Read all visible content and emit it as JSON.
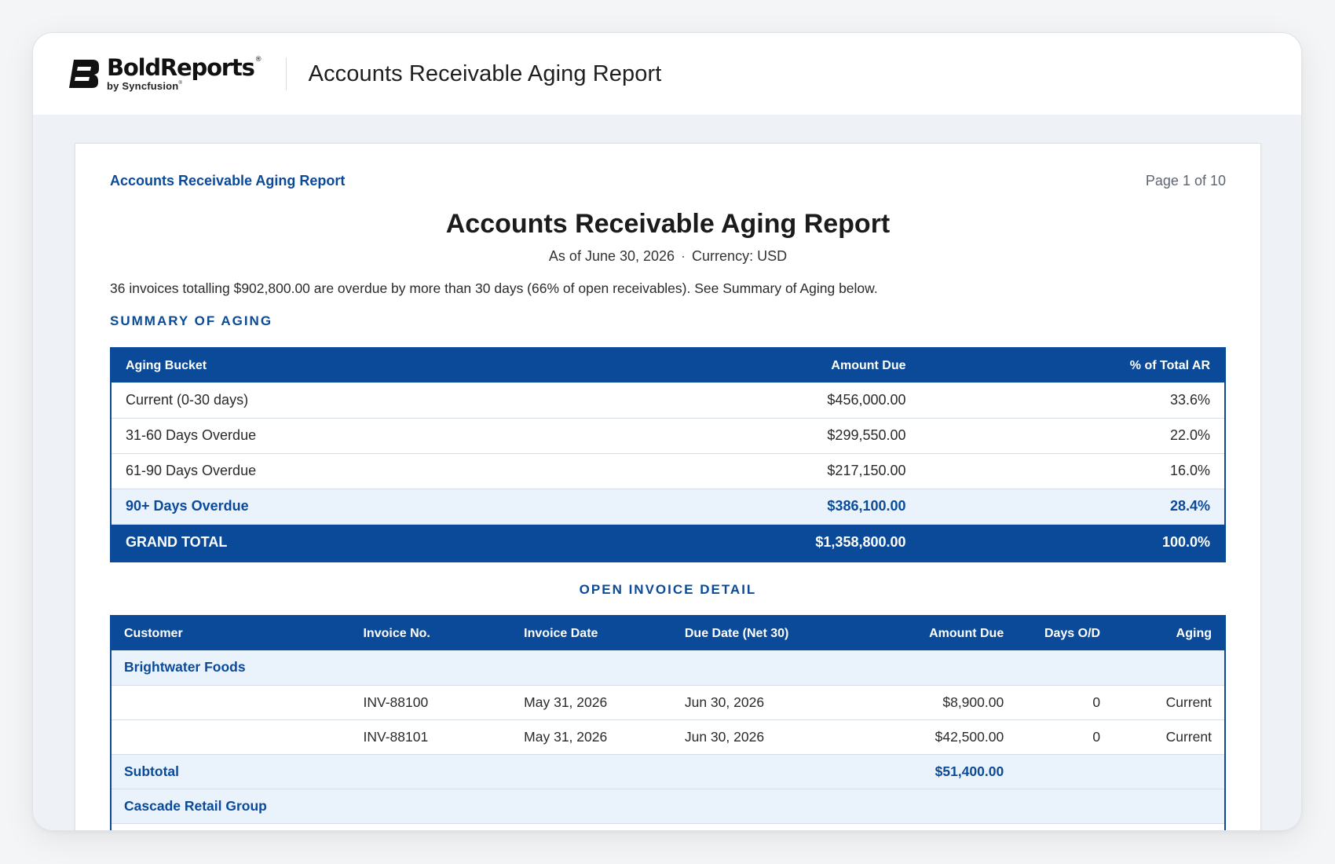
{
  "app": {
    "brand": "BoldReports",
    "brand_mark": "®",
    "sub": "by Syncfusion",
    "sub_mark": "®",
    "title": "Accounts Receivable Aging Report"
  },
  "page": {
    "running_title": "Accounts Receivable Aging Report",
    "page_number": "Page 1 of 10",
    "title": "Accounts Receivable Aging Report",
    "as_of": "As of June 30, 2026",
    "separator": "·",
    "currency": "Currency: USD",
    "intro": "36 invoices totalling $902,800.00 are overdue by more than 30 days (66% of open receivables). See Summary of Aging below."
  },
  "summary": {
    "heading": "SUMMARY OF AGING",
    "columns": [
      "Aging Bucket",
      "Amount Due",
      "% of Total AR"
    ],
    "rows": [
      {
        "bucket": "Current (0-30 days)",
        "amount": "$456,000.00",
        "pct": "33.6%"
      },
      {
        "bucket": "31-60 Days Overdue",
        "amount": "$299,550.00",
        "pct": "22.0%"
      },
      {
        "bucket": "61-90 Days Overdue",
        "amount": "$217,150.00",
        "pct": "16.0%"
      },
      {
        "bucket": "90+ Days Overdue",
        "amount": "$386,100.00",
        "pct": "28.4%"
      }
    ],
    "total": {
      "label": "GRAND TOTAL",
      "amount": "$1,358,800.00",
      "pct": "100.0%"
    }
  },
  "detail": {
    "heading": "OPEN INVOICE DETAIL",
    "columns": [
      "Customer",
      "Invoice No.",
      "Invoice Date",
      "Due Date (Net 30)",
      "Amount Due",
      "Days O/D",
      "Aging"
    ],
    "groups": [
      {
        "customer": "Brightwater Foods",
        "rows": [
          {
            "invoice": "INV-88100",
            "invoice_date": "May 31, 2026",
            "due_date": "Jun 30, 2026",
            "amount": "$8,900.00",
            "days": "0",
            "aging": "Current"
          },
          {
            "invoice": "INV-88101",
            "invoice_date": "May 31, 2026",
            "due_date": "Jun 30, 2026",
            "amount": "$42,500.00",
            "days": "0",
            "aging": "Current"
          }
        ],
        "subtotal_label": "Subtotal",
        "subtotal_amount": "$51,400.00"
      },
      {
        "customer": "Cascade Retail Group"
      }
    ]
  },
  "colors": {
    "accent": "#0a4a99",
    "highlight_row": "#eaf3fc"
  }
}
